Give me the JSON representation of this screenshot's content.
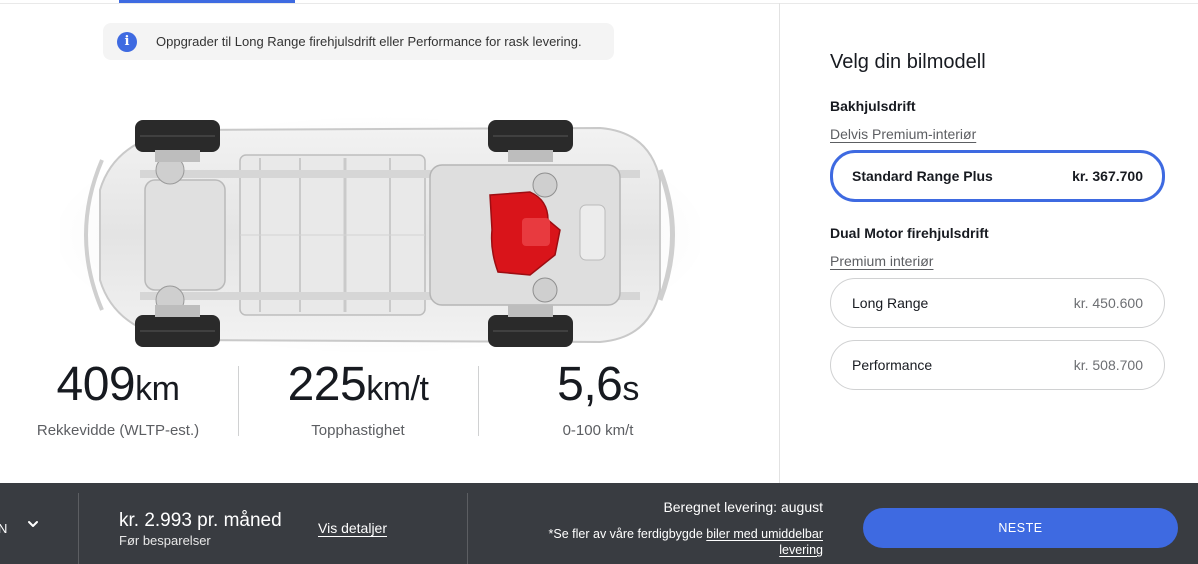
{
  "info_banner": {
    "icon": "info-icon",
    "text": "Oppgrader til Long Range firehjulsdrift eller Performance for rask levering."
  },
  "specs": [
    {
      "value": "409",
      "unit": "km",
      "label": "Rekkevidde (WLTP-est.)"
    },
    {
      "value": "225",
      "unit": "km/t",
      "label": "Topphastighet"
    },
    {
      "value": "5,6",
      "unit": "s",
      "label": "0-100 km/t"
    }
  ],
  "panel": {
    "title": "Velg din bilmodell",
    "groups": [
      {
        "title": "Bakhjulsdrift",
        "subtitle": "Delvis Premium-interiør",
        "options": [
          {
            "name": "Standard Range Plus",
            "price": "kr. 367.700",
            "selected": true
          }
        ]
      },
      {
        "title": "Dual Motor firehjulsdrift",
        "subtitle": "Premium interiør",
        "options": [
          {
            "name": "Long Range",
            "price": "kr. 450.600",
            "selected": false
          },
          {
            "name": "Performance",
            "price": "kr. 508.700",
            "selected": false
          }
        ]
      }
    ]
  },
  "footer": {
    "left_cut_text": "N",
    "monthly": "kr. 2.993 pr. måned",
    "monthly_sub": "Før besparelser",
    "details_link": "Vis detaljer",
    "delivery": "Beregnet levering: august",
    "note_prefix": "*Se fler av våre ferdigbygde ",
    "note_link": "biler med umiddelbar levering",
    "next_button": "NESTE"
  },
  "colors": {
    "accent": "#3e6ae1",
    "footer_bg": "#393c41",
    "motor_red": "#d9141a"
  }
}
